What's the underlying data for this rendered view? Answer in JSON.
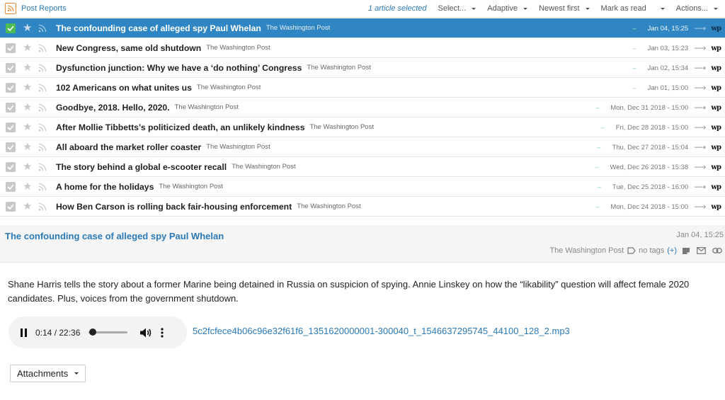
{
  "toolbar": {
    "feed_title": "Post Reports",
    "selection": "1 article selected",
    "select_label": "Select...",
    "mode_label": "Adaptive",
    "sort_label": "Newest first",
    "mark_read_label": "Mark as read",
    "actions_label": "Actions..."
  },
  "headlines": [
    {
      "title": "The confounding case of alleged spy Paul Whelan",
      "source": "The Washington Post",
      "date": "Jan 04, 15:25"
    },
    {
      "title": "New Congress, same old shutdown",
      "source": "The Washington Post",
      "date": "Jan 03, 15:23"
    },
    {
      "title": "Dysfunction junction: Why we have a ‘do nothing’ Congress",
      "source": "The Washington Post",
      "date": "Jan 02, 15:34"
    },
    {
      "title": "102 Americans on what unites us",
      "source": "The Washington Post",
      "date": "Jan 01, 15:00"
    },
    {
      "title": "Goodbye, 2018. Hello, 2020.",
      "source": "The Washington Post",
      "date": "Mon, Dec 31 2018 - 15:00"
    },
    {
      "title": "After Mollie Tibbetts’s politicized death, an unlikely kindness",
      "source": "The Washington Post",
      "date": "Fri, Dec 28 2018 - 15:00"
    },
    {
      "title": "All aboard the market roller coaster",
      "source": "The Washington Post",
      "date": "Thu, Dec 27 2018 - 15:04"
    },
    {
      "title": "The story behind a global e-scooter recall",
      "source": "The Washington Post",
      "date": "Wed, Dec 26 2018 - 15:38"
    },
    {
      "title": "A home for the holidays",
      "source": "The Washington Post",
      "date": "Tue, Dec 25 2018 - 16:00"
    },
    {
      "title": "How Ben Carson is rolling back fair-housing enforcement",
      "source": "The Washington Post",
      "date": "Mon, Dec 24 2018 - 15:00"
    }
  ],
  "article": {
    "title": "The confounding case of alleged spy Paul Whelan",
    "date": "Jan 04, 15:25",
    "source": "The Washington Post",
    "tags": "no tags",
    "add_tag": "(+)",
    "body": "Shane Harris tells the story about a former Marine being detained in Russia on suspicion of spying. Annie Linskey on how the “likability” question will affect female 2020 candidates. Plus, voices from the government shutdown.",
    "player": {
      "time": "0:14 / 22:36",
      "progress": 0.01
    },
    "enclosure": "5c2fcfece4b06c96e32f61f6_1351620000001-300040_t_1546637295745_44100_128_2.mp3",
    "attachments_label": "Attachments"
  },
  "source_logo": "wp",
  "colors": {
    "accent": "#2f86c2",
    "link": "#2a7ab8",
    "checked": "#4cbb54"
  }
}
